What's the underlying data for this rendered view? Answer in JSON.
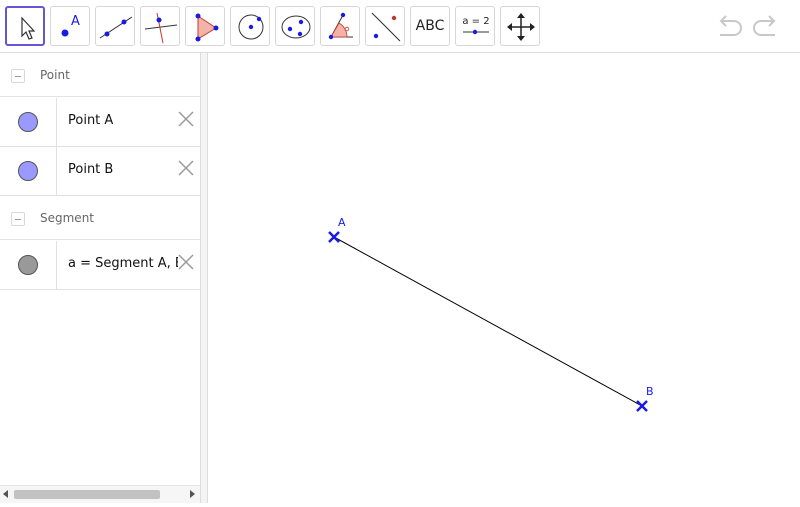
{
  "toolbar": {
    "tools": [
      {
        "name": "move-tool",
        "icon": "arrow-pointer-icon",
        "active": true
      },
      {
        "name": "point-tool",
        "icon": "point-icon",
        "letter": "A"
      },
      {
        "name": "line-tool",
        "icon": "line-icon"
      },
      {
        "name": "perpendicular-line-tool",
        "icon": "perpendicular-icon"
      },
      {
        "name": "polygon-tool",
        "icon": "polygon-icon"
      },
      {
        "name": "circle-center-point-tool",
        "icon": "circle-center-icon"
      },
      {
        "name": "ellipse-tool",
        "icon": "ellipse-icon"
      },
      {
        "name": "angle-tool",
        "icon": "angle-icon"
      },
      {
        "name": "reflect-tool",
        "icon": "reflect-icon"
      },
      {
        "name": "text-tool",
        "icon": "text-icon",
        "label": "ABC"
      },
      {
        "name": "slider-tool",
        "icon": "slider-icon",
        "label": "a = 2"
      },
      {
        "name": "move-graphics-view-tool",
        "icon": "move-cross-icon"
      }
    ],
    "undo_icon": "undo-icon",
    "redo_icon": "redo-icon"
  },
  "algebra": {
    "groups": [
      {
        "label": "Point",
        "items": [
          {
            "label": "Point A",
            "color": "#9999ff"
          },
          {
            "label": "Point B",
            "color": "#9999ff"
          }
        ]
      },
      {
        "label": "Segment",
        "items": [
          {
            "label": "a = Segment A, B",
            "color": "#999999"
          }
        ]
      }
    ]
  },
  "graphics": {
    "points": [
      {
        "name": "A"
      },
      {
        "name": "B"
      }
    ],
    "point_color": "#1a1ae6",
    "segment_color": "#000000"
  }
}
